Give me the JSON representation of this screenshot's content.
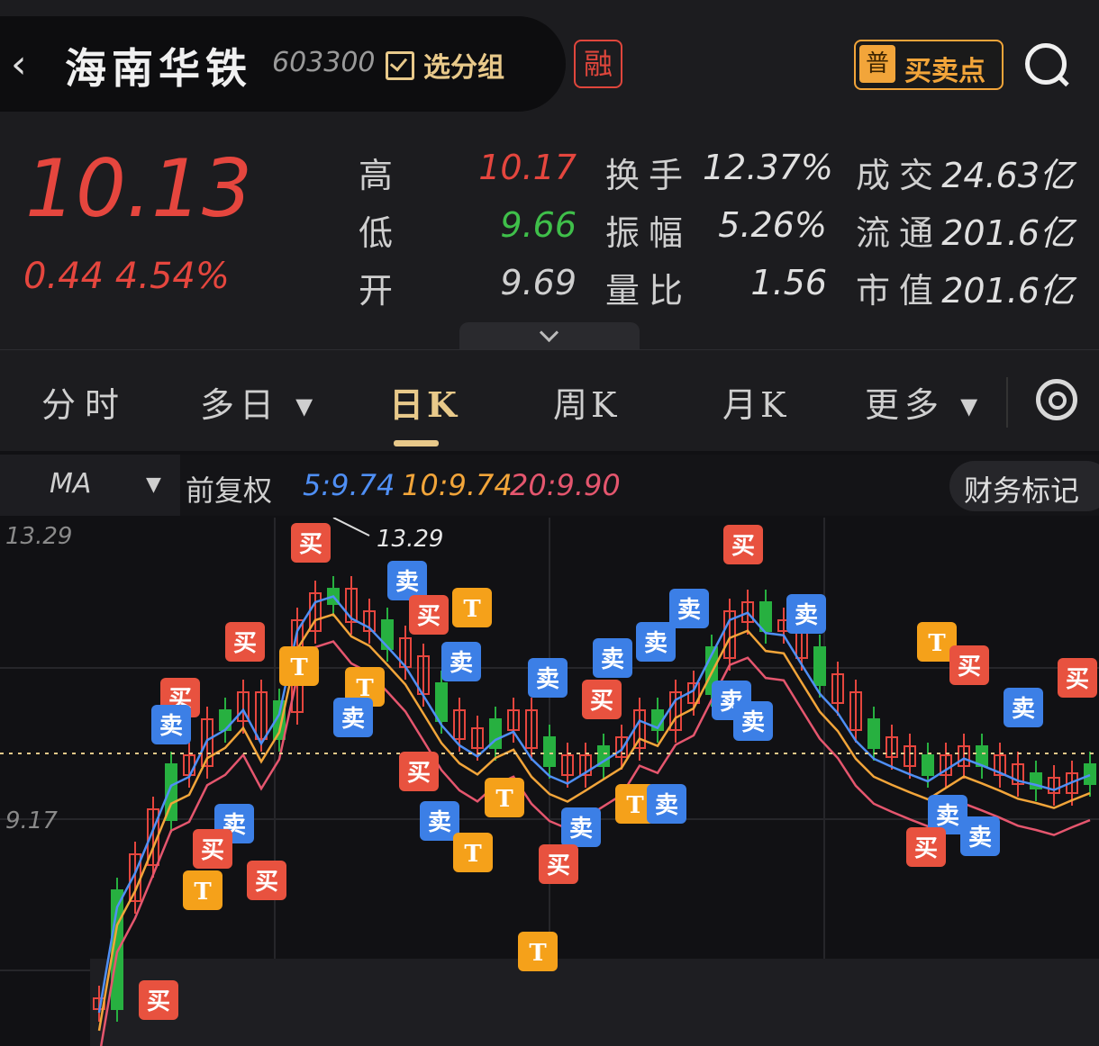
{
  "header": {
    "stock_name": "海南华铁",
    "stock_code": "603300",
    "watchlist_label": "选分组",
    "margin_badge": "融",
    "signal_badge": "普",
    "signal_label": "买卖点"
  },
  "quote": {
    "price": "10.13",
    "change": "0.44 4.54%",
    "stats": [
      {
        "label": "高",
        "value": "10.17",
        "color": "#e5463e"
      },
      {
        "label": "低",
        "value": "9.66",
        "color": "#3fbf4a"
      },
      {
        "label": "开",
        "value": "9.69",
        "color": "#cfcfcf"
      },
      {
        "label": "换手",
        "value": "12.37%",
        "color": "#e0e0e0"
      },
      {
        "label": "振幅",
        "value": "5.26%",
        "color": "#e0e0e0"
      },
      {
        "label": "量比",
        "value": "1.56",
        "color": "#e0e0e0"
      },
      {
        "label": "成交",
        "value": "24.63亿",
        "color": "#e0e0e0"
      },
      {
        "label": "流通",
        "value": "201.6亿",
        "color": "#e0e0e0"
      },
      {
        "label": "市值",
        "value": "201.6亿",
        "color": "#e0e0e0"
      }
    ]
  },
  "tabs": [
    "分时",
    "多日 ▾",
    "日K",
    "周K",
    "月K",
    "更多 ▾"
  ],
  "active_tab": "日K",
  "indicator_bar": {
    "indicator": "MA",
    "adjust": "前复权",
    "ma5": "5:9.74",
    "ma10": "10:9.74",
    "ma20": "20:9.90",
    "financial_marks": "财务标记"
  },
  "chart_data": {
    "type": "candlestick",
    "y_labels": [
      "13.29",
      "9.17"
    ],
    "high_marker": "13.29",
    "current_price_line": 10.13,
    "colors": {
      "up": "#e5463e",
      "down": "#27b040",
      "ma5": "#4f8ff5",
      "ma10": "#f2a53a",
      "ma20": "#e5566e",
      "buy": "#e8523f",
      "sell": "#3c7fe6",
      "t": "#f5a11a"
    },
    "signal_labels": {
      "buy": "买",
      "sell": "卖",
      "t": "T"
    }
  }
}
